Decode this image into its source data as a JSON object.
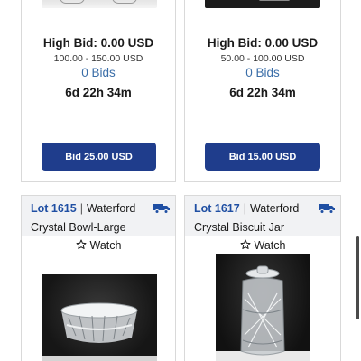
{
  "top_cards": [
    {
      "high_bid": "High Bid: 0.00 USD",
      "estimate": "100.00 - 150.00 USD",
      "bids": "0 Bids",
      "time_left": "6d 22h 34m",
      "bid_button": "Bid 25.00 USD"
    },
    {
      "high_bid": "High Bid: 0.00 USD",
      "estimate": "50.00 - 100.00 USD",
      "bids": "0 Bids",
      "time_left": "6d 22h 34m",
      "bid_button": "Bid 15.00 USD"
    }
  ],
  "bottom_cards": [
    {
      "lot": "Lot 1615",
      "separator": "|",
      "brand": "Waterford",
      "title": "Crystal Bowl-Large",
      "watch": "Watch",
      "shipping_icon": "truck-icon"
    },
    {
      "lot": "Lot 1617",
      "separator": "|",
      "brand": "Waterford",
      "title": "Crystal Biscuit Jar",
      "watch": "Watch",
      "shipping_icon": "truck-icon"
    }
  ],
  "colors": {
    "accent_blue": "#1f3d8c",
    "lot_blue": "#1f4fa3",
    "bids_blue": "#3b6ea8",
    "header_bg": "#f1f2f4"
  }
}
